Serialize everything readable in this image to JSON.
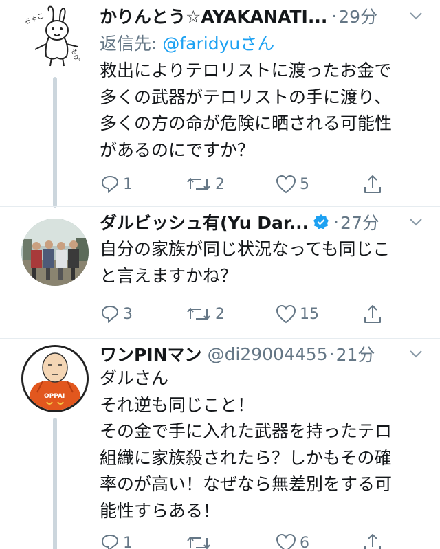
{
  "tweets": [
    {
      "name": "かりんとう☆AYAKANATI...",
      "handle": "",
      "time": "29分",
      "reply_prefix": "返信先: ",
      "reply_mention": "@faridyu",
      "reply_suffix": "さん",
      "lines": [
        "救出によりテロリストに渡ったお金で",
        "多くの武器がテロリストの手に渡り、",
        "多くの方の命が危険に晒される可能性",
        "があるのにですか？"
      ],
      "replies": "1",
      "retweets": "2",
      "likes": "5"
    },
    {
      "name": "ダルビッシュ有(Yu Dar...",
      "verified": true,
      "handle": "",
      "time": "27分",
      "lines": [
        "自分の家族が同じ状況なっても同じこ",
        "と言えますかね？"
      ],
      "replies": "3",
      "retweets": "2",
      "likes": "15"
    },
    {
      "name": "ワンPINマン",
      "handle": "@di29004455",
      "time": "21分",
      "lines": [
        "ダルさん",
        "それ逆も同じこと！",
        "その金で手に入れた武器を持ったテロ",
        "組織に家族殺されたら？しかもその確",
        "率のが高い！なぜなら無差別をする可",
        "能性すらある！"
      ],
      "replies": "1",
      "retweets": "",
      "likes": "6"
    }
  ],
  "colors": {
    "text": "#14171a",
    "muted": "#657786",
    "link": "#1da1f2",
    "thread_line": "#ccd6dd",
    "divider": "#e6ecf0"
  },
  "icons": {
    "reply": "reply-icon",
    "retweet": "retweet-icon",
    "like": "heart-icon",
    "share": "share-icon",
    "more": "chevron-down-icon",
    "verified": "verified-badge-icon"
  },
  "avatar_text": {
    "t1": "ちゃこ もげてる",
    "t3": "OPPAI"
  }
}
